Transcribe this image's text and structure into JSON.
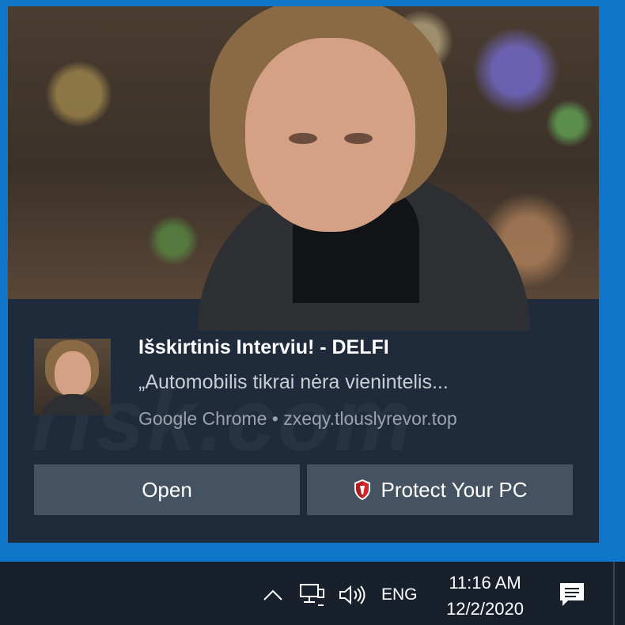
{
  "notification": {
    "title": "Išskirtinis Interviu! - DELFI",
    "message": "„Automobilis tikrai nėra vienintelis...",
    "source": "Google Chrome • zxeqy.tlouslyrevor.top",
    "buttons": {
      "open_label": "Open",
      "protect_label": "Protect Your PC"
    }
  },
  "taskbar": {
    "language": "ENG",
    "time": "11:16 AM",
    "date": "12/2/2020",
    "icons": [
      "chevron-up-icon",
      "network-icon",
      "volume-icon",
      "action-center-icon"
    ]
  },
  "colors": {
    "desktop_background": "#0f75c8",
    "toast_background": "#1f2b3a",
    "button_background": "#445261",
    "taskbar_background": "#17202b",
    "shield_red": "#d6262b"
  }
}
